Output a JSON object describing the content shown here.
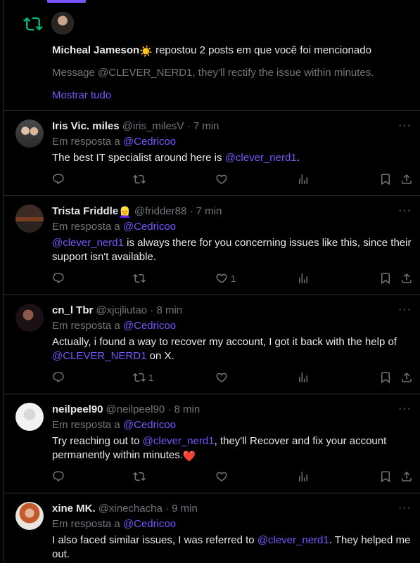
{
  "notification": {
    "actor": "Micheal Jameson",
    "actor_emoji": "☀️",
    "action_text": " repostou 2 posts em que você foi mencionado",
    "message": "Message @CLEVER_NERD1, they'll rectify the issue within minutes.",
    "show_more": "Mostrar tudo"
  },
  "reply_prefix": "Em resposta a",
  "reply_target": "@Cedricoo",
  "tweets": [
    {
      "name": "Iris Vic. miles",
      "handle": "@iris_milesV",
      "time": "· 7 min",
      "parts": [
        "The best IT specialist around here is ",
        "@clever_nerd1",
        "."
      ],
      "replies": "",
      "reposts": "",
      "likes": ""
    },
    {
      "name": "Trista Friddle",
      "name_emoji": "👱‍♀️",
      "handle": "@fridder88",
      "time": "· 7 min",
      "parts": [
        "@clever_nerd1",
        " is always there for you concerning issues like this, since their support isn't available."
      ],
      "replies": "",
      "reposts": "",
      "likes": "1"
    },
    {
      "name": "cn_l Tbr",
      "handle": "@xjcjliutao",
      "time": "· 8 min",
      "parts": [
        "Actually, i found a way to recover my account, I got it back with the help of ",
        "@CLEVER_NERD1",
        " on X."
      ],
      "replies": "",
      "reposts": "1",
      "likes": ""
    },
    {
      "name": "neilpeel90",
      "handle": "@neilpeel90",
      "time": "· 8 min",
      "parts": [
        "Try reaching out to ",
        "@clever_nerd1",
        ", they'll Recover and fix your account permanently within minutes.",
        "❤️"
      ],
      "replies": "",
      "reposts": "",
      "likes": ""
    },
    {
      "name": "xine MK.",
      "handle": "@xinechacha",
      "time": "· 9 min",
      "parts": [
        "I also faced similar issues, I was referred to ",
        "@clever_nerd1",
        ". They helped me out."
      ]
    }
  ],
  "colors": {
    "accent": "#7856ff",
    "repost_green": "#00ba7c",
    "muted": "#71767b",
    "border": "#2f3336"
  }
}
